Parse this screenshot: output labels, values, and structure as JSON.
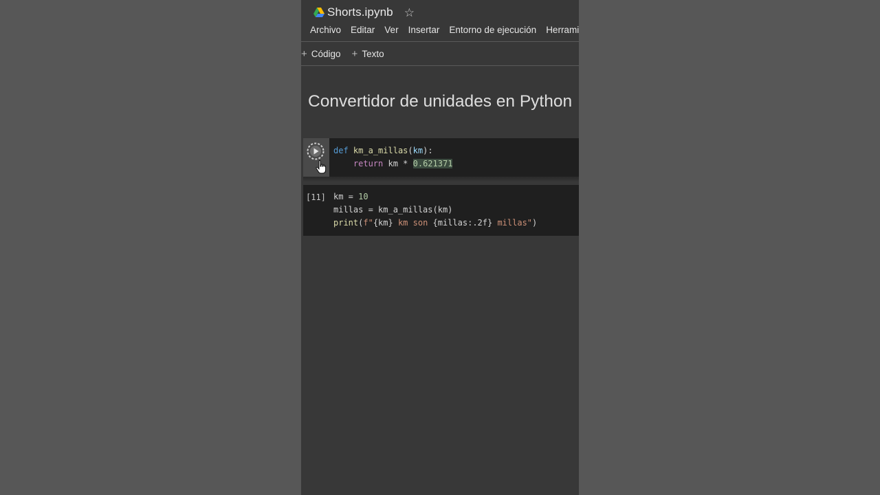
{
  "header": {
    "file_title": "Shorts.ipynb",
    "menu": [
      "Archivo",
      "Editar",
      "Ver",
      "Insertar",
      "Entorno de ejecución",
      "Herrami"
    ]
  },
  "toolbar": {
    "code_label": "Código",
    "text_label": "Texto",
    "plus": "+"
  },
  "notebook": {
    "heading": "Convertidor de unidades en Python",
    "cell1": {
      "line1": {
        "kw": "def",
        "fn": "km_a_millas",
        "open": "(",
        "param": "km",
        "close": "):"
      },
      "line2": {
        "indent": "    ",
        "kw": "return",
        "rest": " km * ",
        "num": "0.621371"
      }
    },
    "cell2": {
      "exec_count": "[11]",
      "line1": {
        "a": "km = ",
        "num": "10"
      },
      "line2": {
        "a": "millas = km_a_millas(km)"
      },
      "line3": {
        "fn": "print",
        "open": "(",
        "str": "f\"",
        "p1": "{km}",
        "s2": " km son ",
        "p2": "{millas:.2f}",
        "s3": " millas\"",
        "close": ")"
      }
    }
  },
  "colors": {
    "background": "#575757",
    "notebook": "#383838",
    "cell": "#1f1f1f",
    "keyword": "#569cd6",
    "keyword_control": "#c586c0",
    "function": "#dcdcaa",
    "number": "#b5cea8",
    "string": "#ce9178"
  },
  "icons": {
    "drive": "google-drive-icon",
    "star": "star-icon",
    "run": "run-cell-icon",
    "cursor": "hand-cursor-icon"
  }
}
